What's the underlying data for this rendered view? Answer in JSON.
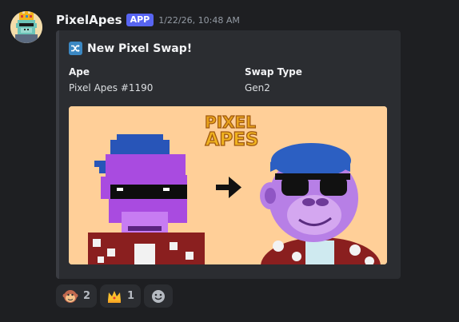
{
  "message": {
    "username": "PixelApes",
    "badge": "APP",
    "timestamp": "1/22/26, 10:48 AM"
  },
  "embed": {
    "title_icon": "shuffle-icon",
    "title": "New Pixel Swap!",
    "fields": [
      {
        "name": "Ape",
        "value": "Pixel Apes #1190"
      },
      {
        "name": "Swap Type",
        "value": "Gen2"
      }
    ],
    "image": {
      "logo_line1": "PIXEL",
      "logo_line2": "APES"
    }
  },
  "reactions": [
    {
      "emoji": "monkey-face-icon",
      "count": "2"
    },
    {
      "emoji": "crown-icon",
      "count": "1"
    }
  ],
  "add_reaction_icon": "smiley-icon",
  "colors": {
    "background": "#1e1f22",
    "embed_bg": "#2b2d31",
    "badge": "#5865f2"
  }
}
